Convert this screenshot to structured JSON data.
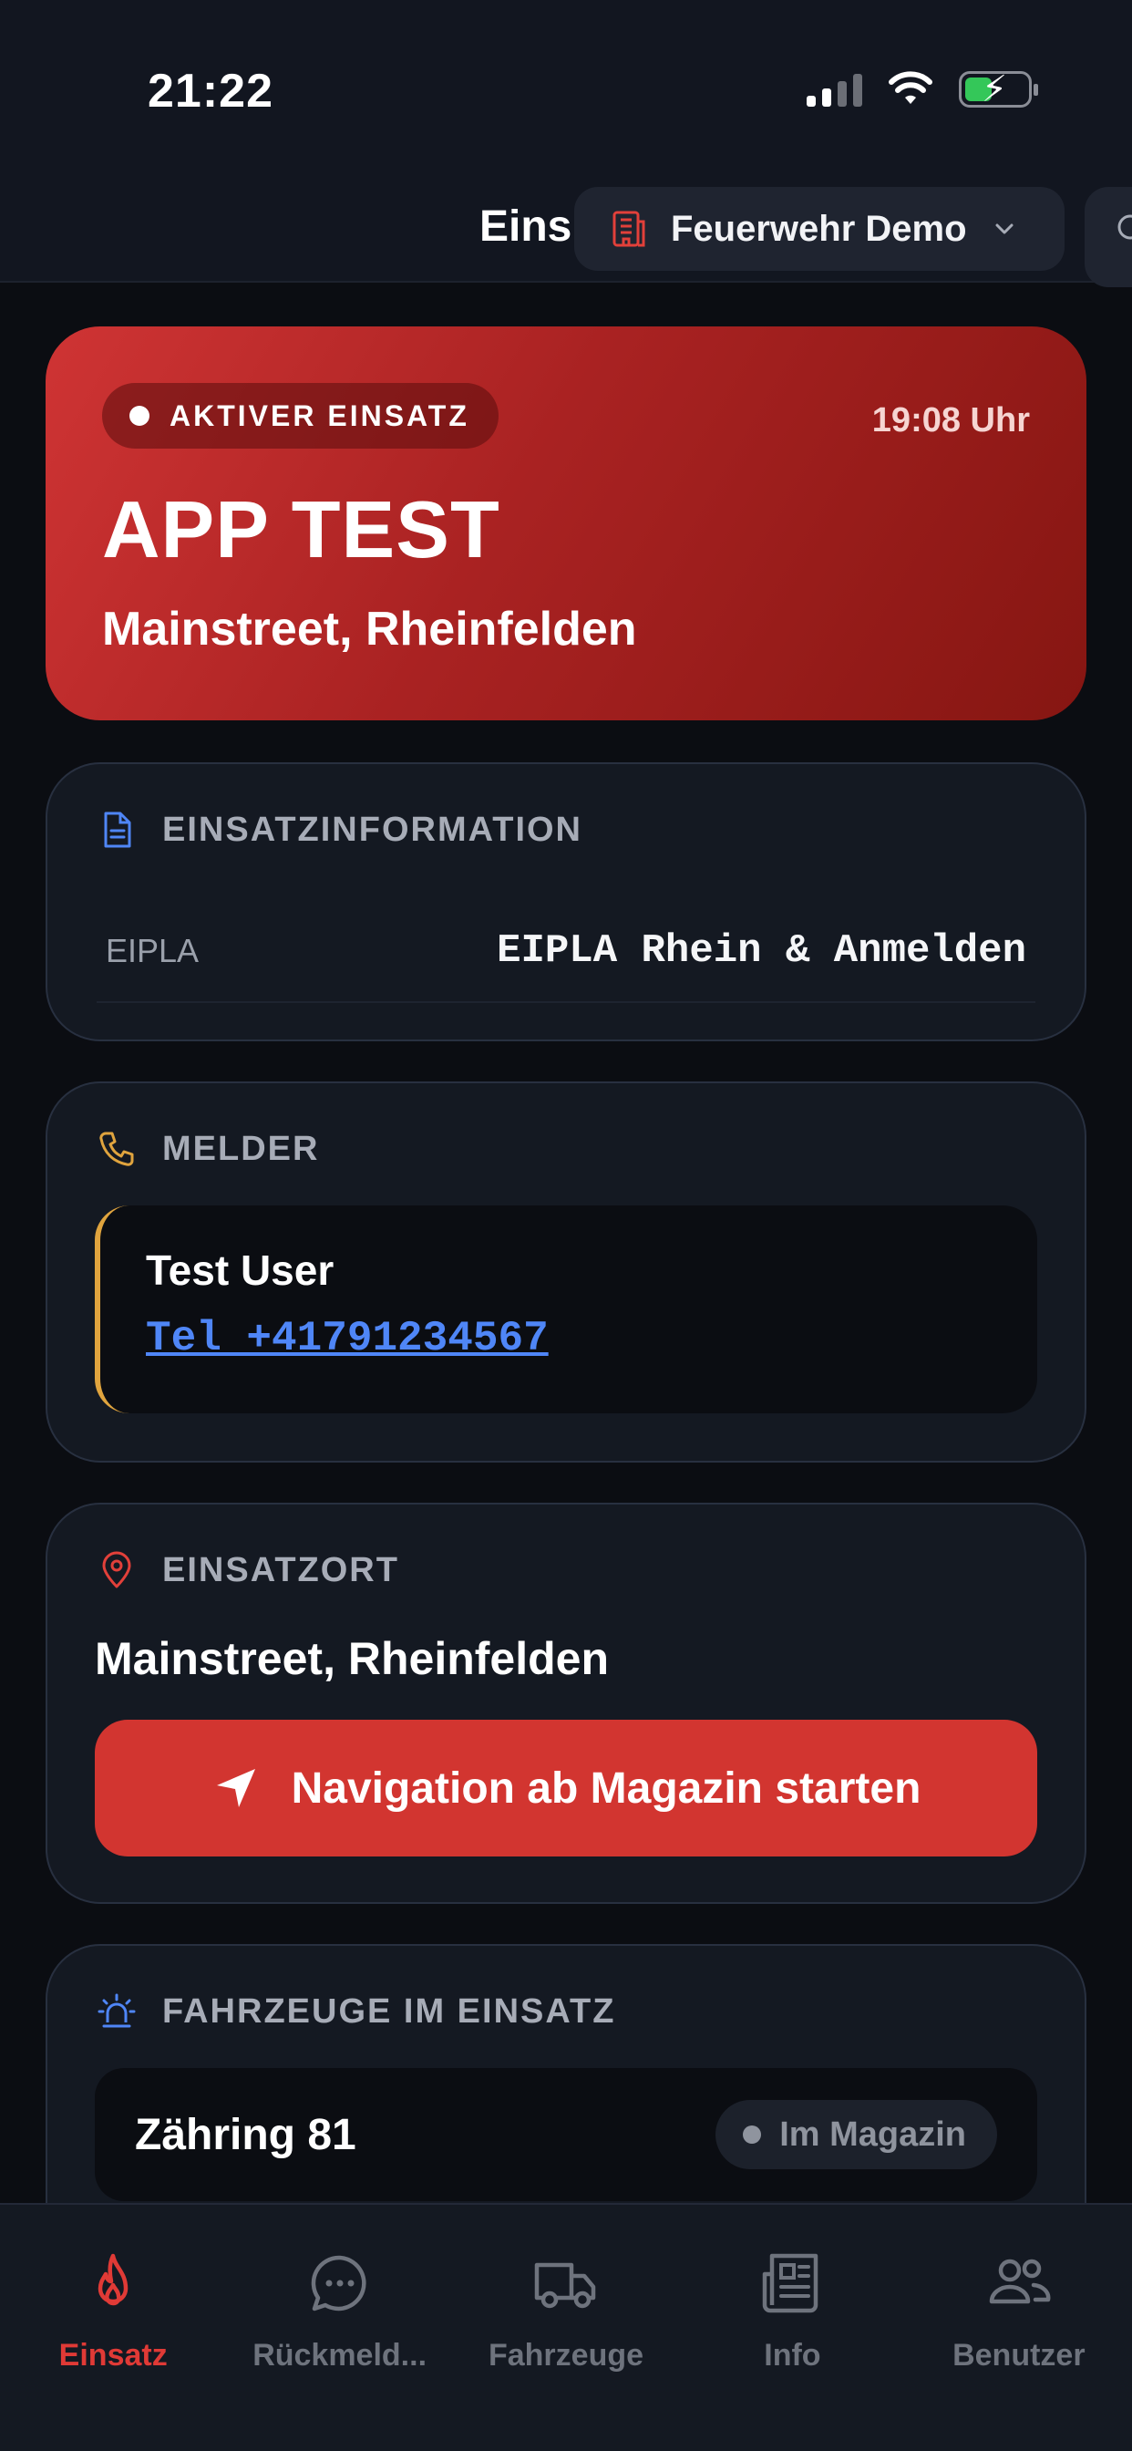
{
  "status_bar": {
    "time": "21:22"
  },
  "header": {
    "title": "Eins",
    "org_name": "Feuerwehr Demo"
  },
  "incident": {
    "badge": "AKTIVER EINSATZ",
    "time": "19:08 Uhr",
    "title": "APP TEST",
    "address": "Mainstreet, Rheinfelden"
  },
  "info_card": {
    "heading": "EINSATZINFORMATION",
    "rows": [
      {
        "key": "EIPLA",
        "value": "EIPLA Rhein & Anmelden"
      }
    ]
  },
  "caller_card": {
    "heading": "MELDER",
    "name": "Test User",
    "phone": "Tel +41791234567"
  },
  "location_card": {
    "heading": "EINSATZORT",
    "address": "Mainstreet, Rheinfelden",
    "nav_button": "Navigation ab Magazin starten"
  },
  "vehicles_card": {
    "heading": "FAHRZEUGE IM EINSATZ",
    "vehicles": [
      {
        "name": "Zähring 81",
        "status": "Im Magazin"
      }
    ]
  },
  "tabbar": {
    "tabs": [
      {
        "label": "Einsatz",
        "icon": "flame-icon",
        "active": true
      },
      {
        "label": "Rückmeld...",
        "icon": "chat-bubble-icon",
        "active": false
      },
      {
        "label": "Fahrzeuge",
        "icon": "truck-icon",
        "active": false
      },
      {
        "label": "Info",
        "icon": "newspaper-icon",
        "active": false
      },
      {
        "label": "Benutzer",
        "icon": "users-icon",
        "active": false
      }
    ]
  },
  "colors": {
    "accent_red": "#d23530",
    "link_blue": "#4f86f7",
    "caller_accent": "#e0a43e",
    "background": "#0b0d12",
    "card": "#141922"
  }
}
